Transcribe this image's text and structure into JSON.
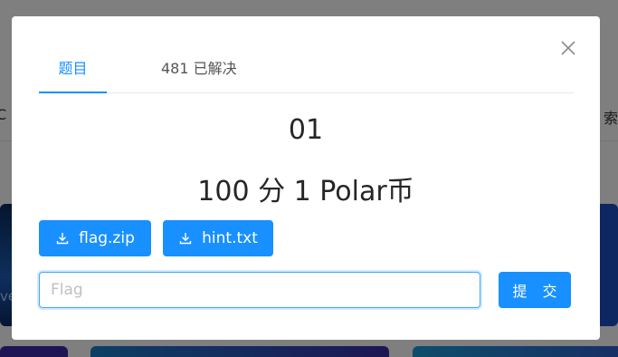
{
  "background": {
    "left_text": "C",
    "right_text": "索",
    "card_text": "ve"
  },
  "modal": {
    "tabs": [
      {
        "label": "题目",
        "active": true
      },
      {
        "label": "481 已解决",
        "active": false
      }
    ],
    "problem": {
      "title": "01",
      "score_line": "100 分 1 Polar币"
    },
    "attachments": [
      {
        "label": "flag.zip",
        "icon": "download-icon"
      },
      {
        "label": "hint.txt",
        "icon": "download-icon"
      }
    ],
    "flag_input": {
      "placeholder": "Flag",
      "value": ""
    },
    "submit_label": "提 交",
    "colors": {
      "accent": "#1890ff",
      "overlay": "rgba(0,0,0,0.5)"
    }
  }
}
